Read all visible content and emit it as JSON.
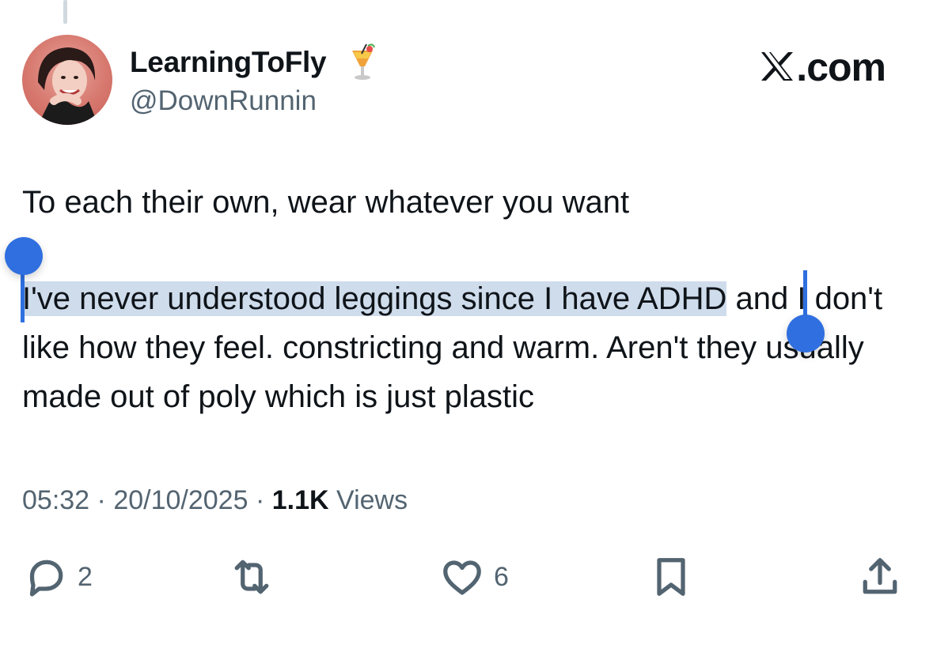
{
  "user": {
    "display_name": "LearningToFly",
    "handle": "@DownRunnin",
    "emoji_icon": "tropical-drink-icon"
  },
  "brand": {
    "label": ".com"
  },
  "post": {
    "line1": "To each their own, wear whatever you want",
    "selected_text": "I've never understood leggings since I have ADHD",
    "rest_text": " and I don't like how they feel. constricting and warm. Aren't they usually made out of poly which is just plastic"
  },
  "meta": {
    "time": "05:32",
    "date": "20/10/2025",
    "views_count": "1.1K",
    "views_label": "Views"
  },
  "actions": {
    "replies": "2",
    "likes": "6",
    "icons": [
      "reply-icon",
      "repost-icon",
      "like-icon",
      "bookmark-icon",
      "share-icon"
    ]
  },
  "colors": {
    "text": "#0f1419",
    "secondary": "#536471",
    "selection": "#cfdcec",
    "selection_handle": "#2f6fe0"
  }
}
